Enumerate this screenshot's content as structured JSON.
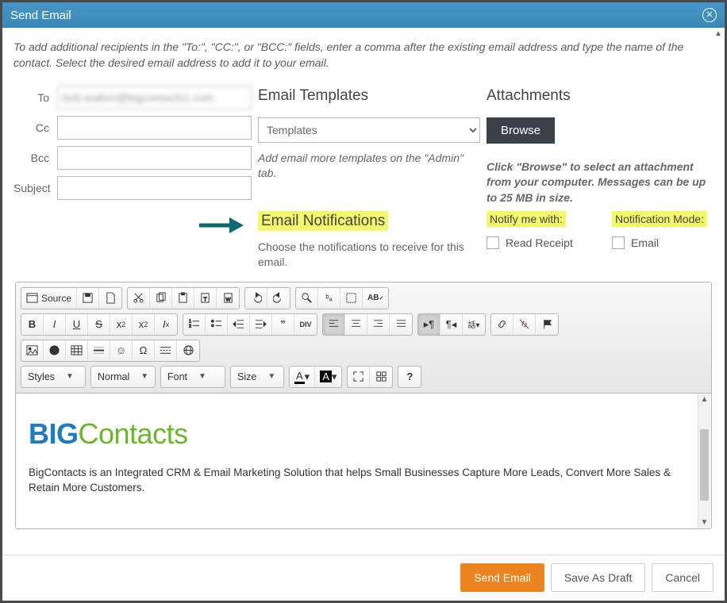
{
  "dialog": {
    "title": "Send Email"
  },
  "help": "To add additional recipients in the \"To:\", \"CC:\", or \"BCC:\" fields, enter a comma after the existing email address and type the name of the contact. Select the desired email address to add it to your email.",
  "fields": {
    "to_label": "To",
    "to_value": "bob.walton@bigcontacts1.com",
    "cc_label": "Cc",
    "cc_value": "",
    "bcc_label": "Bcc",
    "bcc_value": "",
    "subject_label": "Subject",
    "subject_value": ""
  },
  "templates": {
    "title": "Email Templates",
    "select_placeholder": "Templates",
    "hint": "Add email more templates on the \"Admin\" tab."
  },
  "attachments": {
    "title": "Attachments",
    "browse": "Browse",
    "hint": "Click \"Browse\" to select an attachment from your computer. Messages can be up to 25 MB in size."
  },
  "notifications": {
    "title": "Email Notifications",
    "sub": "Choose the notifications to receive for this email.",
    "notify_label": "Notify me with:",
    "mode_label": "Notification Mode:",
    "read_receipt": "Read Receipt",
    "email": "Email"
  },
  "editor": {
    "source": "Source",
    "dropdowns": {
      "styles": "Styles",
      "format": "Normal",
      "font": "Font",
      "size": "Size"
    },
    "body_brand_big": "BIG",
    "body_brand_rest": "Contacts",
    "body_text": "BigContacts is an Integrated CRM & Email Marketing Solution that helps Small Businesses Capture More Leads, Convert More Sales & Retain More Customers."
  },
  "footer": {
    "send": "Send Email",
    "draft": "Save As Draft",
    "cancel": "Cancel"
  }
}
